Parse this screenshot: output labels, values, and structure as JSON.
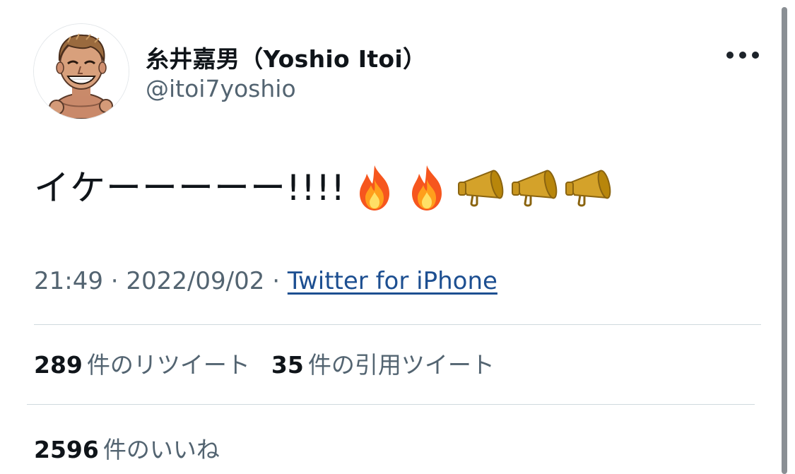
{
  "author": {
    "display_name": "糸井嘉男（Yoshio Itoi）",
    "handle": "@itoi7yoshio"
  },
  "tweet": {
    "text": "イケーーーーー!!!!",
    "emojis": [
      "fire",
      "fire",
      "megaphone",
      "megaphone",
      "megaphone"
    ]
  },
  "meta": {
    "time": "21:49",
    "separator1": " · ",
    "date": "2022/09/02",
    "separator2": " · ",
    "source": "Twitter for iPhone"
  },
  "stats": {
    "retweets": {
      "count": "289",
      "label": "件のリツイート"
    },
    "quotes": {
      "count": "35",
      "label": "件の引用ツイート"
    },
    "likes": {
      "count": "2596",
      "label": "件のいいね"
    }
  },
  "icons": {
    "more": "more-horizontal-icon",
    "fire": "fire-emoji-icon",
    "megaphone": "megaphone-emoji-icon"
  },
  "colors": {
    "text": "#0f1419",
    "muted": "#536471",
    "link": "#1d4f91",
    "divider": "#cfd9de"
  }
}
